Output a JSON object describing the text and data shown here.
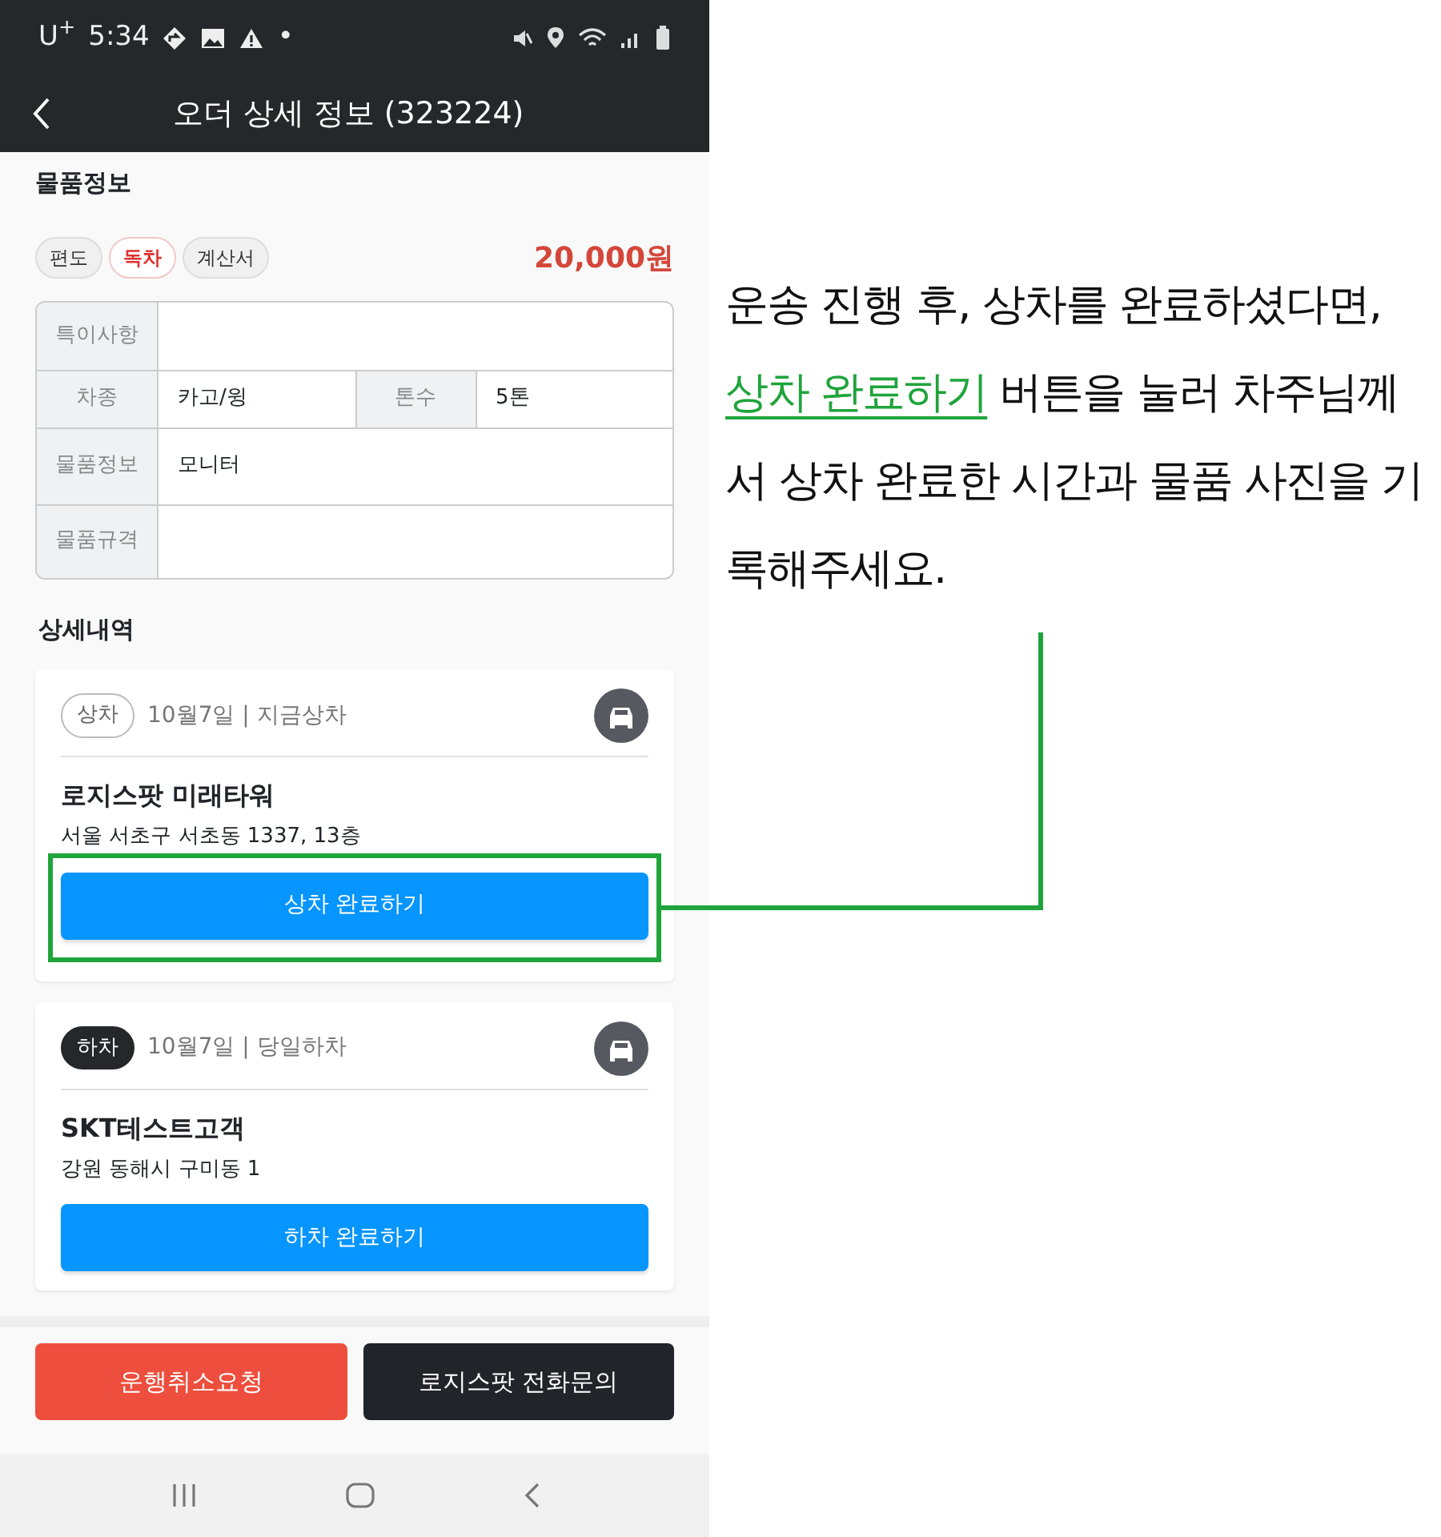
{
  "status_bar": {
    "carrier": "U$^{+}$",
    "time": "5:34",
    "dot": "•"
  },
  "header": {
    "title": "오더 상세 정보 (323224)"
  },
  "goods": {
    "title": "물품정보",
    "tags": [
      {
        "label": "편도",
        "highlighted": false
      },
      {
        "label": "독차",
        "highlighted": true
      },
      {
        "label": "계산서",
        "highlighted": false
      }
    ],
    "price": "20,000원"
  },
  "info_table": [
    {
      "cells": [
        {
          "label": "특이사항"
        }
      ]
    },
    {
      "cells": [
        {
          "label": "차종",
          "value": "카고/윙"
        },
        {
          "label": "톤수",
          "value": "5톤"
        }
      ]
    },
    {
      "cells": [
        {
          "label": "물품정보",
          "value": "모니터"
        }
      ]
    },
    {
      "cells": [
        {
          "label": "물품규격"
        }
      ]
    }
  ],
  "details_title": "상세내역",
  "stops": [
    {
      "kind": "loading",
      "badge": "상차",
      "schedule": "10월7일 | 지금상차",
      "name": "로지스팟 미래타워",
      "address": "서울 서초구 서초동 1337, 13층",
      "button": "상차 완료하기",
      "highlighted": true
    },
    {
      "kind": "unloading",
      "badge": "하차",
      "schedule": "10월7일 | 당일하차",
      "name": "SKT테스트고객",
      "address": "강원 동해시 구미동 1",
      "button": "하차 완료하기",
      "highlighted": false
    }
  ],
  "actions": [
    {
      "kind": "danger",
      "label": "운행취소요청"
    },
    {
      "kind": "dark",
      "label": "로지스팟 전화문의"
    }
  ],
  "callout": {
    "before": "운송 진행 후, 상차를 완료하셨다면, ",
    "link": "상차 완료하기",
    "after": " 버튼을 눌러 차주님께서 상차 완료한 시간과 물품 사진을 기록해주세요."
  }
}
